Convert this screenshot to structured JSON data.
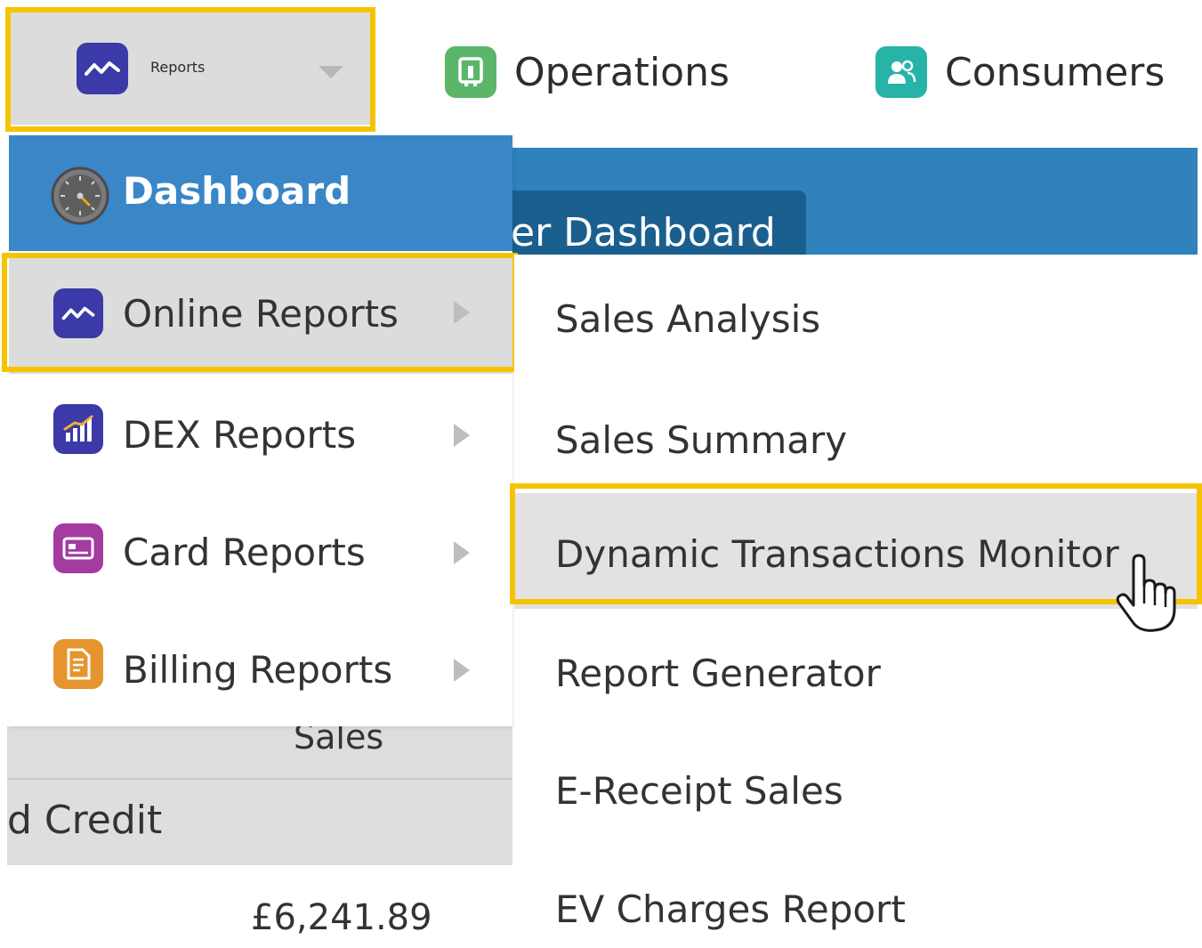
{
  "top_nav": {
    "reports": {
      "label": "Reports",
      "icon": "activity-chart-icon"
    },
    "operations": {
      "label": "Operations",
      "icon": "operations-icon"
    },
    "consumers": {
      "label": "Consumers",
      "icon": "consumers-icon"
    }
  },
  "background_page": {
    "tab_title": "er Dashboard",
    "sales_header": "Sales",
    "credit_label": "d Credit",
    "amount": "£6,241.89"
  },
  "reports_menu": {
    "items": [
      {
        "label": "Dashboard",
        "icon": "gauge-icon"
      },
      {
        "label": "Online Reports",
        "icon": "activity-chart-icon",
        "has_submenu": true,
        "active": true
      },
      {
        "label": "DEX Reports",
        "icon": "bar-chart-icon",
        "has_submenu": true
      },
      {
        "label": "Card Reports",
        "icon": "card-icon",
        "has_submenu": true
      },
      {
        "label": "Billing Reports",
        "icon": "billing-icon",
        "has_submenu": true
      }
    ]
  },
  "online_reports_submenu": {
    "items": [
      {
        "label": "Sales Analysis"
      },
      {
        "label": "Sales Summary"
      },
      {
        "label": "Dynamic Transactions Monitor",
        "hovered": true
      },
      {
        "label": "Report Generator"
      },
      {
        "label": "E-Receipt Sales"
      },
      {
        "label": "EV Charges Report"
      }
    ]
  },
  "colors": {
    "highlight": "#f5c400",
    "dashboard_bg": "#3a86c7",
    "header_band": "#2f82bb",
    "active_row": "#dcdcdc"
  }
}
